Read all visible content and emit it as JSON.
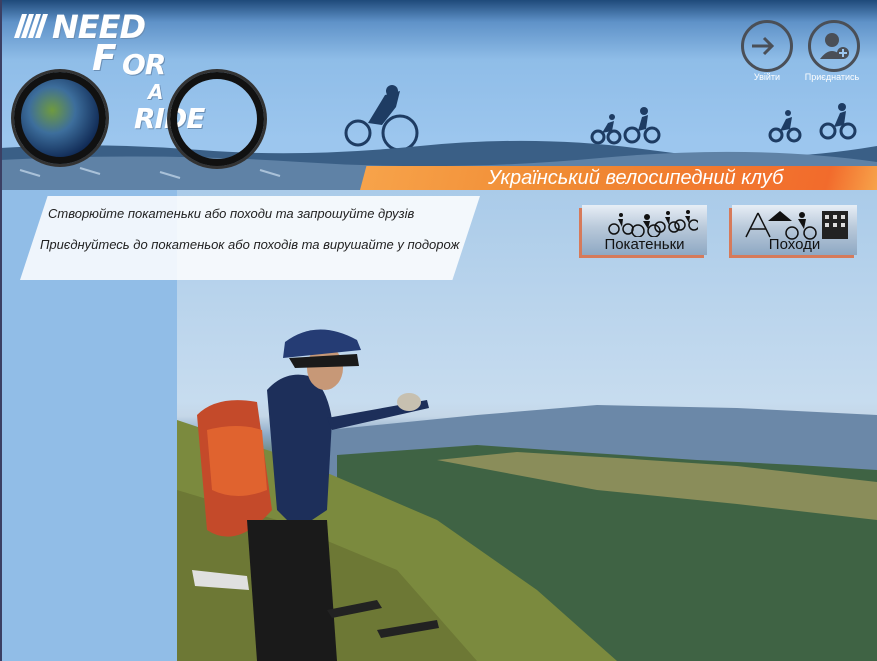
{
  "brand": {
    "need": "NEED",
    "for_f": "F",
    "for_or": "OR",
    "a": "A",
    "ride": "RIDE"
  },
  "header": {
    "login_label": "Увійти",
    "join_label": "Приєднатись",
    "club_title": "Український велосипедний клуб"
  },
  "intro": {
    "line1": "Створюйте покатеньки або походи та запрошуйте друзів",
    "line2": "Приєднуйтесь до покатеньок або походів та вирушайте у подорож"
  },
  "nav": {
    "rides_label": "Покатеньки",
    "trips_label": "Походи"
  },
  "colors": {
    "sky": "#8fbde8",
    "banner_orange": "#f08a33",
    "button_shadow": "#d67a5a"
  }
}
